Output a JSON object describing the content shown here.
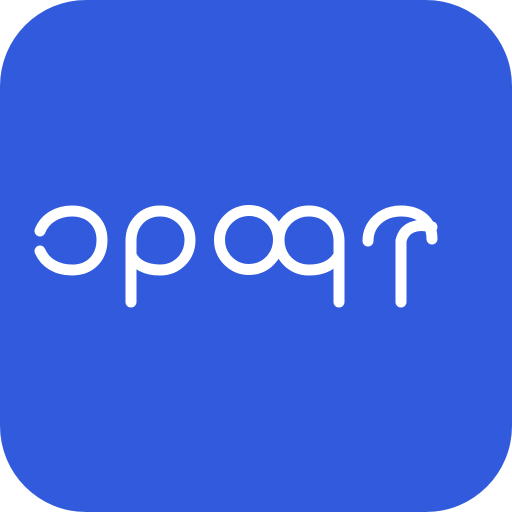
{
  "app_icon": {
    "background_color": "#315BDC",
    "glyph_color": "#FFFFFF",
    "logo_wordmark": "opopt",
    "logo_icon": "custom-rounded-wordmark-icon"
  }
}
